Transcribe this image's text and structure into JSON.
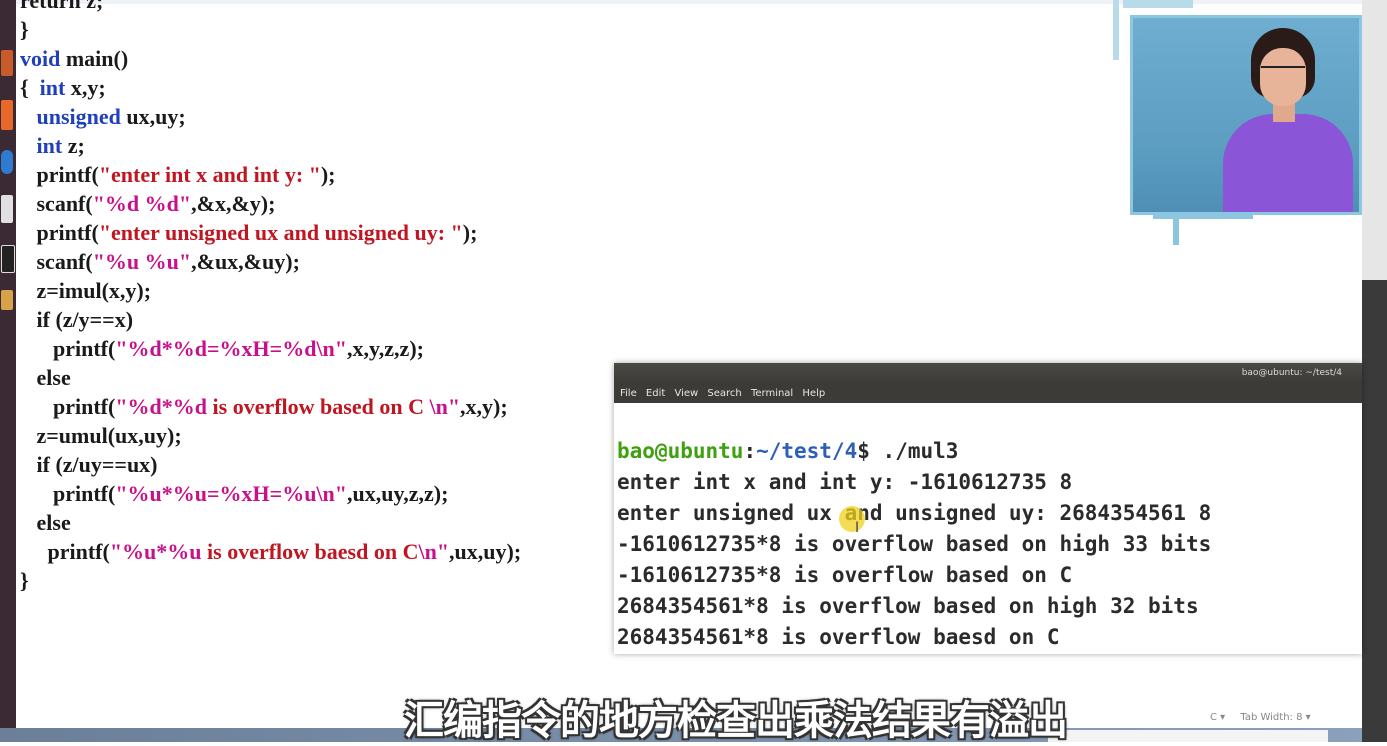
{
  "code_lines": [
    [
      {
        "t": "return z;",
        "c": ""
      }
    ],
    [
      {
        "t": "}",
        "c": ""
      }
    ],
    [
      {
        "t": "void",
        "c": "kw"
      },
      {
        "t": " main()",
        "c": ""
      }
    ],
    [
      {
        "t": "{  ",
        "c": ""
      },
      {
        "t": "int",
        "c": "kw"
      },
      {
        "t": " x,y;",
        "c": ""
      }
    ],
    [
      {
        "t": "   ",
        "c": ""
      },
      {
        "t": "unsigned",
        "c": "kw"
      },
      {
        "t": " ux,uy;",
        "c": ""
      }
    ],
    [
      {
        "t": "   ",
        "c": ""
      },
      {
        "t": "int",
        "c": "kw"
      },
      {
        "t": " z;",
        "c": ""
      }
    ],
    [
      {
        "t": "   printf(",
        "c": ""
      },
      {
        "t": "\"enter int x and int y: \"",
        "c": "str"
      },
      {
        "t": ");",
        "c": ""
      }
    ],
    [
      {
        "t": "   scanf(",
        "c": ""
      },
      {
        "t": "\"%d %d\"",
        "c": "fmt"
      },
      {
        "t": ",&x,&y);",
        "c": ""
      }
    ],
    [
      {
        "t": "   printf(",
        "c": ""
      },
      {
        "t": "\"enter unsigned ux and unsigned uy: \"",
        "c": "str"
      },
      {
        "t": ");",
        "c": ""
      }
    ],
    [
      {
        "t": "   scanf(",
        "c": ""
      },
      {
        "t": "\"%u %u\"",
        "c": "fmt"
      },
      {
        "t": ",&ux,&uy);",
        "c": ""
      }
    ],
    [
      {
        "t": "   z=imul(x,y);",
        "c": ""
      }
    ],
    [
      {
        "t": "   if (z/y==x)",
        "c": ""
      }
    ],
    [
      {
        "t": "      printf(",
        "c": ""
      },
      {
        "t": "\"%d*%d=%xH=%d\\n\"",
        "c": "fmt"
      },
      {
        "t": ",x,y,z,z);",
        "c": ""
      }
    ],
    [
      {
        "t": "   else",
        "c": ""
      }
    ],
    [
      {
        "t": "      printf(",
        "c": ""
      },
      {
        "t": "\"%d*%d ",
        "c": "fmt"
      },
      {
        "t": "is overflow based on C ",
        "c": "str"
      },
      {
        "t": "\\n\"",
        "c": "fmt"
      },
      {
        "t": ",x,y);",
        "c": ""
      }
    ],
    [
      {
        "t": "   z=umul(ux,uy);",
        "c": ""
      }
    ],
    [
      {
        "t": "   if (z/uy==ux)",
        "c": ""
      }
    ],
    [
      {
        "t": "      printf(",
        "c": ""
      },
      {
        "t": "\"%u*%u=%xH=%u\\n\"",
        "c": "fmt"
      },
      {
        "t": ",ux,uy,z,z);",
        "c": ""
      }
    ],
    [
      {
        "t": "   else",
        "c": ""
      }
    ],
    [
      {
        "t": "     printf(",
        "c": ""
      },
      {
        "t": "\"%u*%u ",
        "c": "fmt"
      },
      {
        "t": "is overflow baesd on C",
        "c": "str"
      },
      {
        "t": "\\n\"",
        "c": "fmt"
      },
      {
        "t": ",ux,uy);",
        "c": ""
      }
    ],
    [
      {
        "t": "}",
        "c": ""
      }
    ]
  ],
  "terminal": {
    "title": "bao@ubuntu: ~/test/4",
    "menu": [
      "File",
      "Edit",
      "View",
      "Search",
      "Terminal",
      "Help"
    ],
    "prompt_user": "bao@ubuntu",
    "prompt_sep": ":",
    "prompt_path": "~/test/4",
    "prompt_end": "$",
    "command": " ./mul3",
    "output": [
      "enter int x and int y: -1610612735 8",
      "enter unsigned ux and unsigned uy: 2684354561 8",
      "-1610612735*8 is overflow based on high 33 bits",
      "-1610612735*8 is overflow based on C",
      "2684354561*8 is overflow based on high 32 bits",
      "2684354561*8 is overflow baesd on C"
    ]
  },
  "status": {
    "language": "C ▾",
    "tab_width": "Tab Width: 8 ▾"
  },
  "subtitle": "汇编指令的地方检查出乘法结果有溢出",
  "colors": {
    "keyword": "#1f3fbf",
    "string": "#c01622",
    "format": "#c8108a",
    "prompt_user": "#3fa010",
    "prompt_path": "#2e5fb8"
  }
}
